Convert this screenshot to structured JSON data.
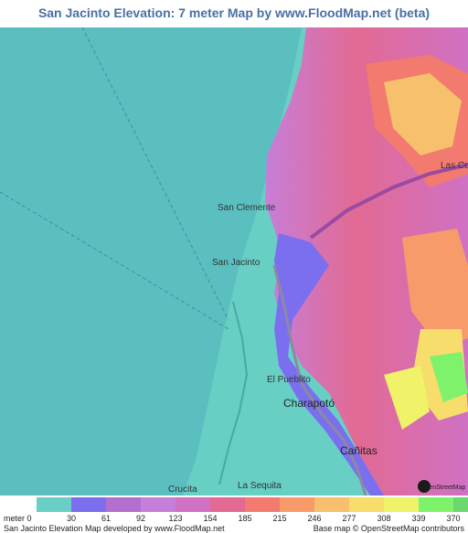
{
  "title": "San Jacinto Elevation: 7 meter Map by www.FloodMap.net (beta)",
  "map": {
    "labels": {
      "san_clemente": "San Clemente",
      "san_jacinto": "San Jacinto",
      "el_pueblito": "El Pueblito",
      "charapoto": "Charapotó",
      "canitas": "Cañitas",
      "la_sequita": "La Sequita",
      "las_cortes": "Las Co",
      "crucita": "Crucita"
    },
    "osm_logo": "OpenStreetMap"
  },
  "legend": {
    "unit": "meter",
    "values": [
      "0",
      "30",
      "61",
      "92",
      "123",
      "154",
      "185",
      "215",
      "246",
      "277",
      "308",
      "339",
      "370"
    ],
    "colors": [
      "#68cfc5",
      "#7b6ff0",
      "#b46fce",
      "#c77ed8",
      "#d071c4",
      "#e26a93",
      "#f27a6e",
      "#f79b6a",
      "#f7c06d",
      "#f6dd6c",
      "#f0f26a",
      "#7ff26c",
      "#6ad86c"
    ],
    "credit_left": "San Jacinto Elevation Map developed by www.FloodMap.net",
    "credit_right": "Base map © OpenStreetMap contributors"
  }
}
